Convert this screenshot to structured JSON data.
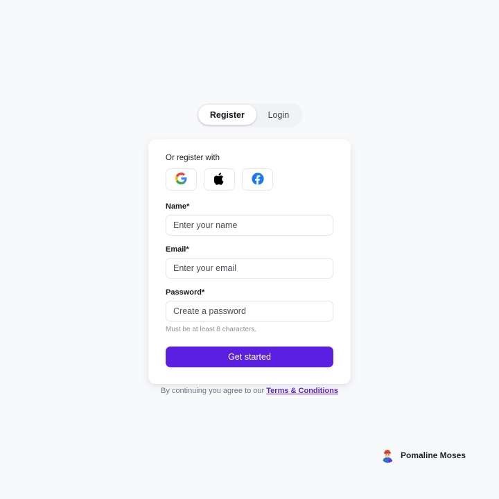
{
  "page": {
    "background_color": "#f8f9fb",
    "accent_color": "#5a1fe0"
  },
  "tabs": [
    {
      "label": "Register",
      "active": true,
      "name": "tab-register"
    },
    {
      "label": "Login",
      "active": false,
      "name": "tab-login"
    }
  ],
  "card": {
    "social": {
      "label": "Or register with",
      "providers": [
        {
          "name": "google-icon",
          "label": "Google"
        },
        {
          "name": "apple-icon",
          "label": "Apple"
        },
        {
          "name": "facebook-icon",
          "label": "Facebook"
        }
      ]
    },
    "fields": [
      {
        "label": "Name*",
        "placeholder": "Enter your name",
        "value": "",
        "helper": ""
      },
      {
        "label": "Email*",
        "placeholder": "Enter your email",
        "value": "",
        "helper": ""
      },
      {
        "label": "Password*",
        "placeholder": "Create a password",
        "value": "",
        "helper": "Must be at least 8 characters."
      }
    ],
    "submit_label": "Get started"
  },
  "footer": {
    "text": "By continuing you agree to our",
    "link_label": "Terms & Conditions"
  },
  "user": {
    "name": "Pomaline Moses",
    "avatar_icon": "avatar-icon"
  }
}
